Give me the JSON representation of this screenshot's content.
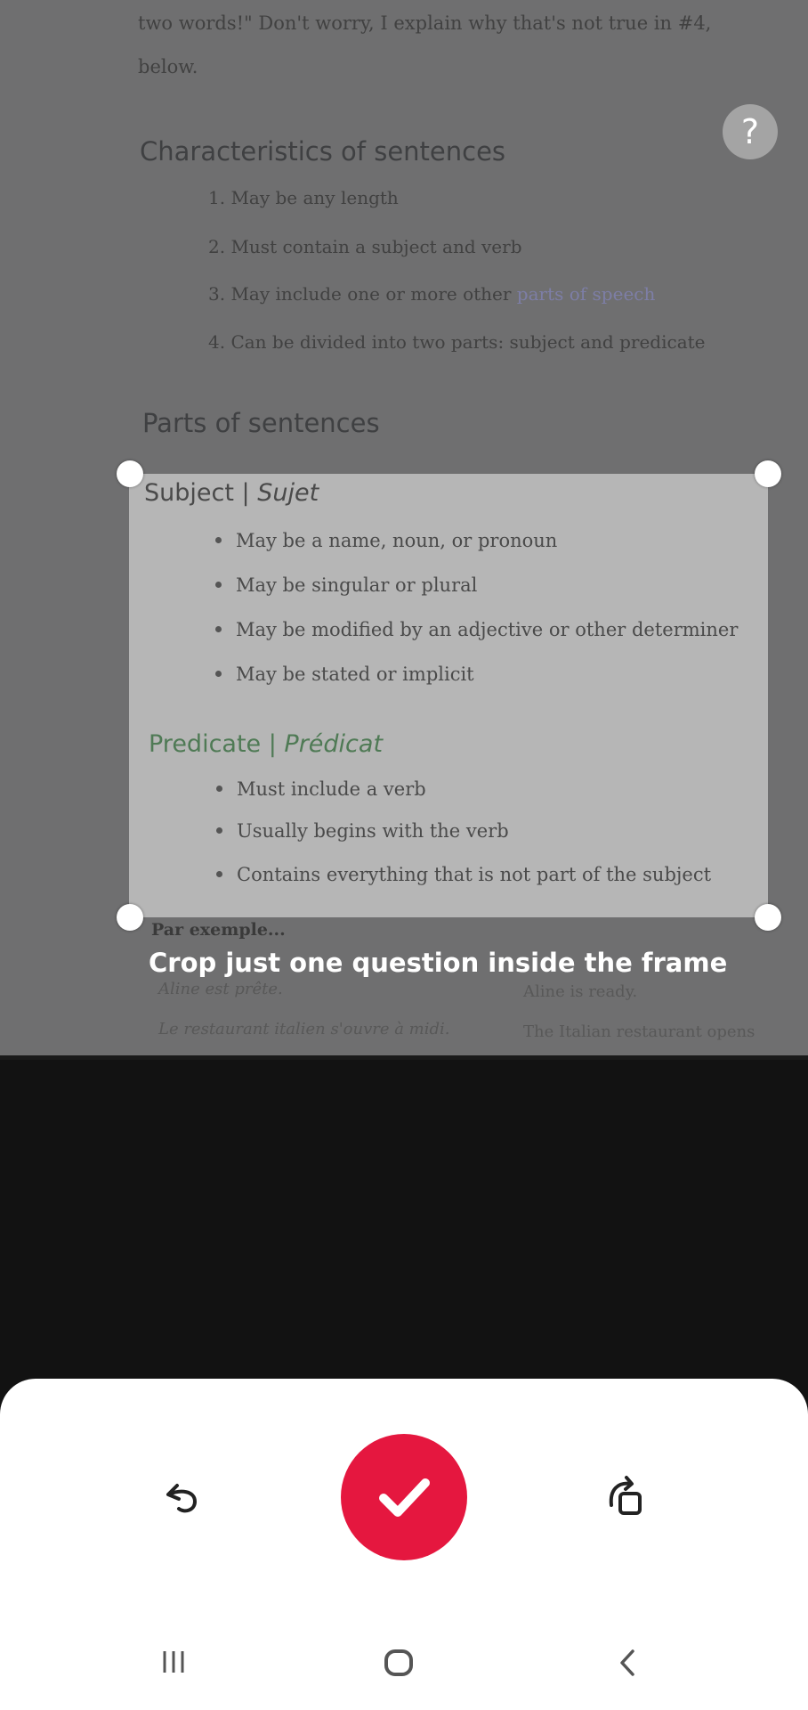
{
  "document": {
    "top_line1": "two words!\" Don't worry, I explain why that's not true in #4,",
    "top_line2": "below.",
    "characteristics_heading": "Characteristics of sentences",
    "characteristics": [
      {
        "text": "1. May be any length"
      },
      {
        "text": "2. Must contain a subject and verb"
      },
      {
        "text": "3. May include one or more other ",
        "link": "parts of speech"
      },
      {
        "text": "4. Can be divided into two parts: subject and predicate"
      }
    ],
    "parts_heading": "Parts of sentences",
    "subject_heading": "Subject | ",
    "subject_heading_italic": "Sujet",
    "subject_items": [
      "May be a name, noun, or pronoun",
      "May be singular or plural",
      "May be modified by an adjective or other determiner",
      "May be stated or implicit"
    ],
    "predicate_heading": "Predicate | ",
    "predicate_heading_italic": "Prédicat",
    "predicate_items": [
      "Must include a verb",
      "Usually begins with the verb",
      "Contains everything that is not part of the subject"
    ],
    "example_label": "Par exemple...",
    "example_fr1": "Aline est prête.",
    "example_en1": "Aline is ready.",
    "example_fr2": "Le restaurant italien s'ouvre à midi.",
    "example_en2": "The Italian restaurant opens"
  },
  "overlay": {
    "help_label": "?",
    "instruction": "Crop just one question inside the frame"
  },
  "controls": {
    "undo_icon": "rotate-left-icon",
    "confirm_icon": "checkmark-icon",
    "redo_icon": "rotate-right-icon"
  },
  "nav": {
    "recent_icon": "recent-apps-icon",
    "home_icon": "home-icon",
    "back_icon": "back-icon"
  },
  "colors": {
    "accent": "#e5173f",
    "sheet": "#ffffff",
    "green_heading": "#4f7a55"
  }
}
